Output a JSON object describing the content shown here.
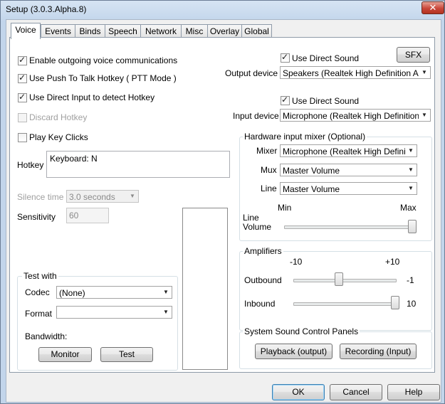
{
  "window": {
    "title": "Setup (3.0.3.Alpha.8)",
    "close_label": "✕"
  },
  "tabs": [
    {
      "label": "Voice",
      "active": true
    },
    {
      "label": "Events"
    },
    {
      "label": "Binds"
    },
    {
      "label": "Speech"
    },
    {
      "label": "Network"
    },
    {
      "label": "Misc"
    },
    {
      "label": "Overlay"
    },
    {
      "label": "Global"
    }
  ],
  "voice": {
    "enable_outgoing": {
      "label": "Enable outgoing voice communications",
      "checked": true
    },
    "push_to_talk": {
      "label": "Use Push To Talk Hotkey ( PTT Mode )",
      "checked": true
    },
    "direct_input": {
      "label": "Use Direct Input to detect Hotkey",
      "checked": true
    },
    "discard_hotkey": {
      "label": "Discard Hotkey",
      "checked": false,
      "disabled": true
    },
    "play_key_clicks": {
      "label": "Play Key Clicks",
      "checked": false
    },
    "hotkey": {
      "label": "Hotkey",
      "value": "Keyboard: N"
    },
    "silence_time": {
      "label": "Silence time",
      "value": "3.0 seconds"
    },
    "sensitivity": {
      "label": "Sensitivity",
      "value": "60"
    },
    "test_with": {
      "title": "Test with",
      "codec_label": "Codec",
      "codec_value": "(None)",
      "format_label": "Format",
      "format_value": "",
      "bandwidth_label": "Bandwidth:",
      "monitor_label": "Monitor",
      "test_label": "Test"
    },
    "output": {
      "use_direct_sound": {
        "label": "Use Direct Sound",
        "checked": true
      },
      "sfx_label": "SFX",
      "device_label": "Output device",
      "device_value": "Speakers (Realtek High Definition Audio"
    },
    "input": {
      "use_direct_sound": {
        "label": "Use Direct Sound",
        "checked": true
      },
      "device_label": "Input device",
      "device_value": "Microphone (Realtek High Definition Aud"
    },
    "mixer": {
      "title": "Hardware input mixer (Optional)",
      "mixer_label": "Mixer",
      "mixer_value": "Microphone (Realtek High Defini",
      "mux_label": "Mux",
      "mux_value": "Master Volume",
      "line_label": "Line",
      "line_value": "Master Volume",
      "min_label": "Min",
      "max_label": "Max",
      "line_volume_label_1": "Line",
      "line_volume_label_2": "Volume",
      "line_volume_level": 1.0
    },
    "amplifiers": {
      "title": "Amplifiers",
      "min_label": "-10",
      "max_label": "+10",
      "outbound_label": "Outbound",
      "outbound_value": "-1",
      "inbound_label": "Inbound",
      "inbound_value": "10"
    },
    "system_sound": {
      "title": "System Sound Control Panels",
      "playback_label": "Playback (output)",
      "recording_label": "Recording (Input)"
    }
  },
  "footer": {
    "ok_label": "OK",
    "cancel_label": "Cancel",
    "help_label": "Help"
  }
}
